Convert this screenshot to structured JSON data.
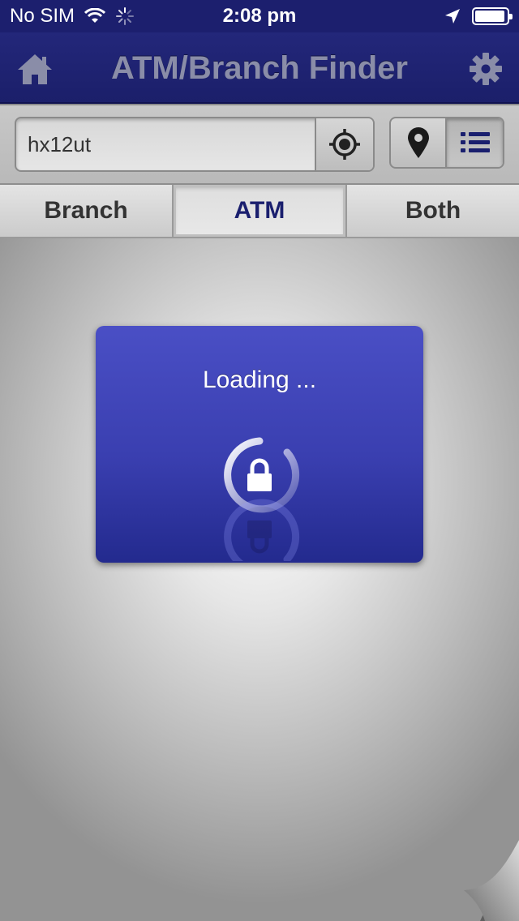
{
  "status_bar": {
    "carrier": "No SIM",
    "time": "2:08 pm"
  },
  "nav": {
    "title": "ATM/Branch Finder",
    "left_icon": "home-icon",
    "right_icon": "gear-icon"
  },
  "search": {
    "value": "hx12ut",
    "locate_icon": "crosshair-icon",
    "map_view_icon": "map-pin-icon",
    "list_view_icon": "list-icon",
    "active_view": "list"
  },
  "tabs": {
    "items": [
      {
        "label": "Branch"
      },
      {
        "label": "ATM"
      },
      {
        "label": "Both"
      }
    ],
    "active": "ATM"
  },
  "loading": {
    "text": "Loading ...",
    "icon": "lock-icon"
  },
  "colors": {
    "nav_background": "#1c1f6e",
    "title_text": "#8a8da8",
    "active_tab_text": "#1a1f6e",
    "dialog_top": "#4a4fc5",
    "dialog_bottom": "#232a8e"
  }
}
